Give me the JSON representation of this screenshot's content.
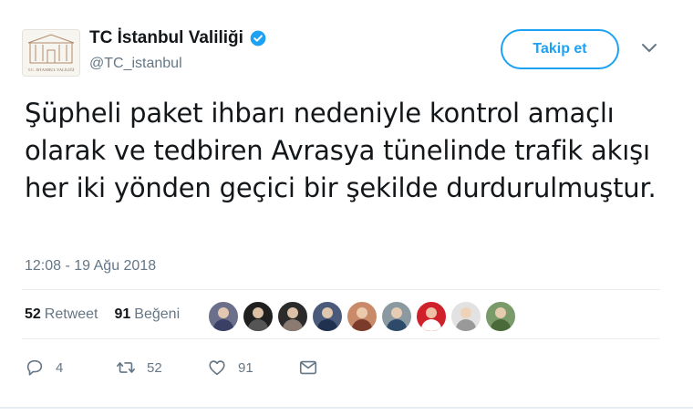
{
  "account": {
    "name": "TC İstanbul Valiliği",
    "handle": "@TC_istanbul",
    "avatar_caption": "T.C. İSTANBUL VALİLİĞİ",
    "verified": true
  },
  "follow_button": {
    "label": "Takip et"
  },
  "tweet": {
    "text": "Şüpheli paket ihbarı nedeniyle kontrol amaçlı olarak ve tedbiren Avrasya tünelinde trafik akışı her iki yönden geçici bir şekilde durdurulmuştur.",
    "timestamp": "12:08 - 19 Ağu 2018"
  },
  "stats": {
    "retweets_count": "52",
    "retweets_label": "Retweet",
    "likes_count": "91",
    "likes_label": "Beğeni"
  },
  "liker_avatars": [
    {
      "bg": "#6b6f8a",
      "body": "#3a3f66"
    },
    {
      "bg": "#1f1f1f",
      "body": "#555555"
    },
    {
      "bg": "#2b2b2b",
      "body": "#8a7a70"
    },
    {
      "bg": "#4a5a7a",
      "body": "#20304f"
    },
    {
      "bg": "#c98a6a",
      "body": "#7a3b2a"
    },
    {
      "bg": "#8a9aa0",
      "body": "#2d4a6a"
    },
    {
      "bg": "#d0202a",
      "body": "#ffffff"
    },
    {
      "bg": "#e2e2e2",
      "body": "#999999"
    },
    {
      "bg": "#7a9a6a",
      "body": "#4a6a3a"
    }
  ],
  "actions": {
    "reply_count": "4",
    "retweet_count": "52",
    "like_count": "91",
    "icons": [
      "reply-icon",
      "retweet-icon",
      "heart-icon",
      "envelope-icon"
    ]
  },
  "colors": {
    "accent": "#1da1f2",
    "verified": "#1da1f2",
    "muted": "#657786",
    "text": "#14171a"
  }
}
